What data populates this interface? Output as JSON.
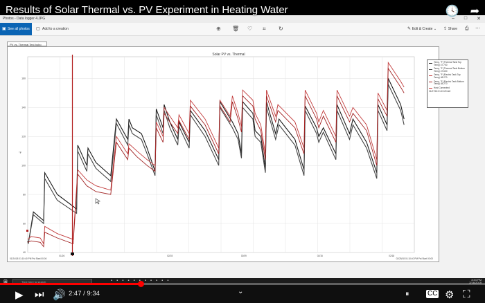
{
  "video": {
    "title": "Results of Solar Thermal vs. PV Experiment in Heating Water",
    "time_current": "2:47",
    "time_separator": " / ",
    "time_total": "9:34",
    "progress": 0.29
  },
  "photos_app": {
    "window_title": "Photos - Data logger 4.JPG",
    "toolbar": {
      "see_all": "See all photos",
      "add_creation": "Add to a creation",
      "edit_create": "Edit & Create",
      "share": "Share"
    },
    "file_tab": "PV vs. Thermal Test.hobo"
  },
  "chart_data": {
    "type": "line",
    "title": "Solar PV vs. Thermal",
    "ylabel": "°F",
    "ylim": [
      40,
      175
    ],
    "y_ticks": [
      40,
      60,
      80,
      100,
      120,
      140,
      160
    ],
    "x_ticks": [
      "01/26",
      "02/03",
      "02/09",
      "02/15",
      "02/18"
    ],
    "x_left_label": "01/24/18 01:10:40 PM  Pst Start 00:00",
    "x_right_label": "02/25/18 01:10:40 PM  Pst Start 00:00",
    "cursor_label": "01/27/18 01:19:20 AM",
    "legend": [
      {
        "label": "Temp, °F (Thermal Tank Top Temp)",
        "sub": "47.700",
        "color": "#1a1a1a"
      },
      {
        "label": "Temp, °F (Thermal Tank Bottom Temp)",
        "sub": "47.600",
        "color": "#4a4a4a"
      },
      {
        "label": "Temp, °F (Electric Tank Top Temp)",
        "sub": "48.270",
        "color": "#c23b3b"
      },
      {
        "label": "Temp, °F (Electric Tank Bottom Temp)",
        "sub": "48.270",
        "color": "#a02020"
      },
      {
        "label": "Host Connected",
        "sub": "",
        "color": "#cc3333"
      }
    ],
    "series": [
      {
        "color": "#1a1a1a",
        "points": [
          [
            0,
            48
          ],
          [
            0.5,
            46
          ],
          [
            5,
            68
          ],
          [
            14,
            62
          ],
          [
            15,
            95
          ],
          [
            26,
            80
          ],
          [
            43,
            70
          ],
          [
            44,
            114
          ],
          [
            52,
            100
          ],
          [
            53,
            112
          ],
          [
            60,
            102
          ],
          [
            73,
            93
          ],
          [
            78,
            132
          ],
          [
            88,
            118
          ],
          [
            89,
            132
          ],
          [
            92,
            126
          ],
          [
            100,
            122
          ],
          [
            105,
            112
          ],
          [
            112,
            96
          ],
          [
            113,
            139
          ],
          [
            119,
            126
          ],
          [
            120,
            142
          ],
          [
            125,
            130
          ],
          [
            132,
            118
          ],
          [
            133,
            130
          ],
          [
            142,
            116
          ],
          [
            143,
            138
          ],
          [
            156,
            124
          ],
          [
            168,
            104
          ],
          [
            169,
            144
          ],
          [
            180,
            130
          ],
          [
            185,
            122
          ],
          [
            188,
            108
          ],
          [
            189,
            144
          ],
          [
            198,
            136
          ],
          [
            200,
            124
          ],
          [
            205,
            120
          ],
          [
            209,
            98
          ],
          [
            210,
            144
          ],
          [
            218,
            122
          ],
          [
            221,
            132
          ],
          [
            235,
            118
          ],
          [
            243,
            97
          ],
          [
            244,
            141
          ],
          [
            254,
            126
          ],
          [
            256,
            120
          ],
          [
            260,
            126
          ],
          [
            271,
            108
          ],
          [
            272,
            142
          ],
          [
            283,
            122
          ],
          [
            286,
            132
          ],
          [
            298,
            116
          ],
          [
            307,
            95
          ],
          [
            308,
            142
          ],
          [
            316,
            128
          ],
          [
            317,
            160
          ],
          [
            328,
            142
          ],
          [
            331,
            132
          ]
        ]
      },
      {
        "color": "#444444",
        "points": [
          [
            0,
            48
          ],
          [
            0.5,
            46
          ],
          [
            5,
            66
          ],
          [
            14,
            60
          ],
          [
            15,
            91
          ],
          [
            26,
            76
          ],
          [
            43,
            67
          ],
          [
            44,
            110
          ],
          [
            52,
            96
          ],
          [
            53,
            108
          ],
          [
            60,
            98
          ],
          [
            73,
            89
          ],
          [
            78,
            129
          ],
          [
            88,
            114
          ],
          [
            89,
            128
          ],
          [
            92,
            122
          ],
          [
            100,
            118
          ],
          [
            105,
            108
          ],
          [
            112,
            93
          ],
          [
            113,
            135
          ],
          [
            119,
            122
          ],
          [
            120,
            138
          ],
          [
            125,
            126
          ],
          [
            132,
            114
          ],
          [
            133,
            127
          ],
          [
            142,
            112
          ],
          [
            143,
            135
          ],
          [
            156,
            120
          ],
          [
            168,
            100
          ],
          [
            169,
            140
          ],
          [
            180,
            126
          ],
          [
            185,
            118
          ],
          [
            188,
            105
          ],
          [
            189,
            140
          ],
          [
            198,
            132
          ],
          [
            200,
            120
          ],
          [
            205,
            116
          ],
          [
            209,
            95
          ],
          [
            210,
            140
          ],
          [
            218,
            118
          ],
          [
            221,
            128
          ],
          [
            235,
            114
          ],
          [
            243,
            93
          ],
          [
            244,
            138
          ],
          [
            254,
            122
          ],
          [
            256,
            116
          ],
          [
            260,
            123
          ],
          [
            271,
            104
          ],
          [
            272,
            138
          ],
          [
            283,
            118
          ],
          [
            286,
            128
          ],
          [
            298,
            112
          ],
          [
            307,
            91
          ],
          [
            308,
            138
          ],
          [
            316,
            124
          ],
          [
            317,
            156
          ],
          [
            328,
            138
          ],
          [
            331,
            128
          ]
        ]
      },
      {
        "color": "#c23b3b",
        "points": [
          [
            0,
            49
          ],
          [
            3,
            51
          ],
          [
            11,
            50
          ],
          [
            14,
            46
          ],
          [
            15,
            58
          ],
          [
            26,
            53
          ],
          [
            40,
            49
          ],
          [
            44,
            97
          ],
          [
            52,
            90
          ],
          [
            60,
            86
          ],
          [
            73,
            83
          ],
          [
            78,
            120
          ],
          [
            88,
            108
          ],
          [
            89,
            115
          ],
          [
            96,
            110
          ],
          [
            105,
            104
          ],
          [
            112,
            100
          ],
          [
            113,
            130
          ],
          [
            119,
            120
          ],
          [
            120,
            140
          ],
          [
            125,
            134
          ],
          [
            132,
            126
          ],
          [
            133,
            135
          ],
          [
            142,
            122
          ],
          [
            143,
            145
          ],
          [
            156,
            132
          ],
          [
            168,
            112
          ],
          [
            169,
            145
          ],
          [
            178,
            134
          ],
          [
            180,
            148
          ],
          [
            185,
            136
          ],
          [
            188,
            127
          ],
          [
            189,
            152
          ],
          [
            198,
            145
          ],
          [
            200,
            136
          ],
          [
            205,
            128
          ],
          [
            209,
            108
          ],
          [
            210,
            152
          ],
          [
            218,
            134
          ],
          [
            220,
            142
          ],
          [
            235,
            130
          ],
          [
            243,
            112
          ],
          [
            244,
            152
          ],
          [
            254,
            136
          ],
          [
            256,
            130
          ],
          [
            260,
            138
          ],
          [
            271,
            120
          ],
          [
            272,
            152
          ],
          [
            283,
            134
          ],
          [
            286,
            140
          ],
          [
            298,
            128
          ],
          [
            307,
            104
          ],
          [
            308,
            150
          ],
          [
            316,
            138
          ],
          [
            317,
            171
          ],
          [
            328,
            158
          ],
          [
            331,
            154
          ]
        ]
      },
      {
        "color": "#a02020",
        "points": [
          [
            0,
            47
          ],
          [
            3,
            48
          ],
          [
            11,
            47
          ],
          [
            14,
            44
          ],
          [
            15,
            54
          ],
          [
            26,
            50
          ],
          [
            40,
            46
          ],
          [
            44,
            94
          ],
          [
            52,
            86
          ],
          [
            60,
            82
          ],
          [
            73,
            80
          ],
          [
            78,
            116
          ],
          [
            88,
            104
          ],
          [
            89,
            112
          ],
          [
            96,
            106
          ],
          [
            105,
            100
          ],
          [
            112,
            96
          ],
          [
            113,
            126
          ],
          [
            119,
            116
          ],
          [
            120,
            136
          ],
          [
            125,
            130
          ],
          [
            132,
            122
          ],
          [
            133,
            131
          ],
          [
            142,
            118
          ],
          [
            143,
            141
          ],
          [
            156,
            128
          ],
          [
            168,
            108
          ],
          [
            169,
            141
          ],
          [
            178,
            130
          ],
          [
            180,
            144
          ],
          [
            185,
            132
          ],
          [
            188,
            123
          ],
          [
            189,
            148
          ],
          [
            198,
            141
          ],
          [
            200,
            132
          ],
          [
            205,
            124
          ],
          [
            209,
            104
          ],
          [
            210,
            148
          ],
          [
            218,
            130
          ],
          [
            220,
            138
          ],
          [
            235,
            126
          ],
          [
            243,
            108
          ],
          [
            244,
            148
          ],
          [
            254,
            132
          ],
          [
            256,
            126
          ],
          [
            260,
            134
          ],
          [
            271,
            116
          ],
          [
            272,
            148
          ],
          [
            283,
            130
          ],
          [
            286,
            136
          ],
          [
            298,
            124
          ],
          [
            307,
            100
          ],
          [
            308,
            146
          ],
          [
            316,
            134
          ],
          [
            317,
            167
          ],
          [
            328,
            154
          ],
          [
            331,
            150
          ]
        ]
      }
    ]
  }
}
